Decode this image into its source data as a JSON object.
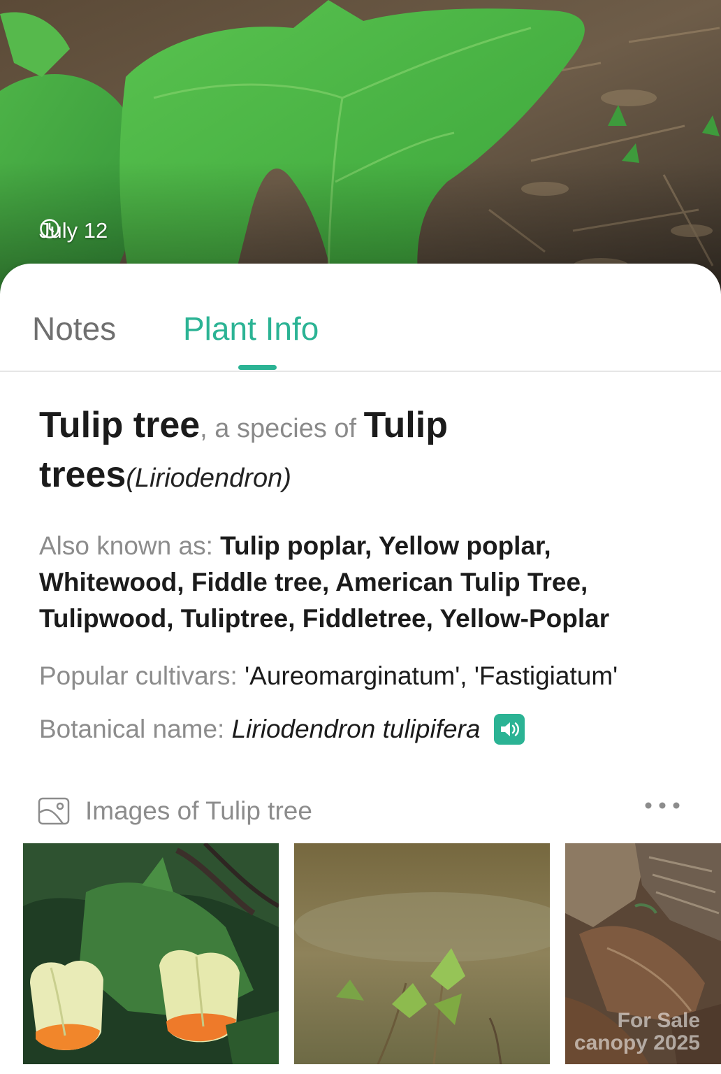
{
  "photo": {
    "date": "July 12",
    "icons": {
      "clock": "clock-icon"
    }
  },
  "tabs": [
    {
      "label": "Notes",
      "active": false
    },
    {
      "label": "Plant Info",
      "active": true
    }
  ],
  "accent_color": "#2bb394",
  "plant": {
    "common_name": "Tulip tree",
    "species_connector": ", a species of ",
    "genus_common": "Tulip trees",
    "genus_latin": "(Liriodendron)",
    "aka_label": "Also known as: ",
    "aka_value": "Tulip poplar, Yellow poplar, Whitewood, Fiddle tree, American Tulip Tree, Tulipwood, Tuliptree, Fiddletree, Yellow-Poplar",
    "cultivars_label": "Popular cultivars: ",
    "cultivars_value": "'Aureomarginatum', 'Fastigiatum'",
    "botanical_label": "Botanical name: ",
    "botanical_value": "Liriodendron tulipifera",
    "icons": {
      "pronounce": "speaker-icon"
    }
  },
  "images": {
    "title": "Images of Tulip tree",
    "icons": {
      "gallery": "gallery-icon",
      "more": "more-dots-icon"
    }
  },
  "watermark": {
    "line1": "For Sale",
    "line2": "canopy 2025"
  }
}
